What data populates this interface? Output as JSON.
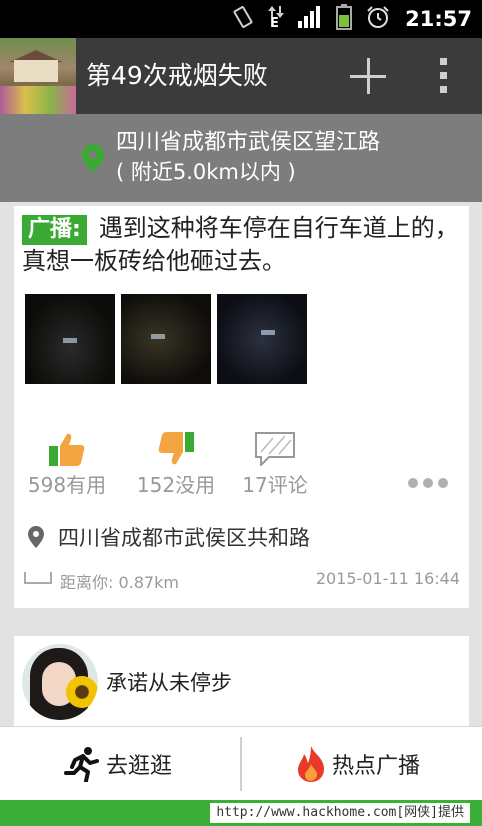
{
  "status_bar": {
    "network_type": "E",
    "time": "21:57",
    "icons": [
      "vibrate-icon",
      "network-arrows-icon",
      "signal-icon",
      "battery-icon",
      "alarm-icon"
    ]
  },
  "action_bar": {
    "title": "第49次戒烟失败",
    "actions": [
      "add-icon",
      "overflow-menu-icon"
    ]
  },
  "location_banner": {
    "address": "四川省成都市武侯区望江路",
    "range": "( 附近5.0km以内 )"
  },
  "post": {
    "tag": "广播:",
    "text": "遇到这种将车停在自行车道上的，真想一板砖给他砸过去。",
    "photo_count": 3,
    "useful_label": "598有用",
    "useless_label": "152没用",
    "comments_label": "17评论",
    "location": "四川省成都市武侯区共和路",
    "distance": "距离你: 0.87km",
    "timestamp": "2015-01-11 16:44"
  },
  "next_post": {
    "user_name": "承诺从未停步"
  },
  "bottom_nav": {
    "explore_label": "去逛逛",
    "hot_label": "热点广播"
  },
  "footer": {
    "credit": "http://www.hackhome.com[网侠]提供"
  },
  "colors": {
    "accent_green": "#3aaa35",
    "action_bar": "#3b3b3b",
    "location_banner": "#7d7d7d",
    "hot_red": "#e8392b"
  }
}
